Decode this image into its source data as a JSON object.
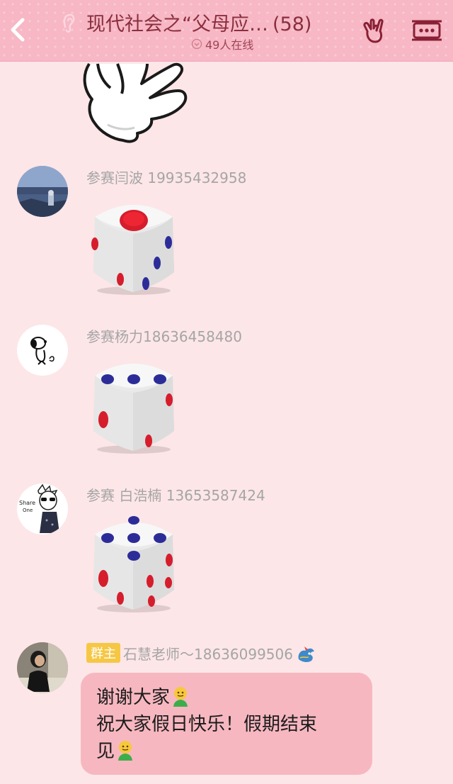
{
  "header": {
    "title": "现代社会之“父母应…",
    "member_count": "(58)",
    "online_status": "49人在线"
  },
  "messages": [
    {
      "sender": "参赛闫波 19935432958",
      "content_type": "dice",
      "dice_value": 1
    },
    {
      "sender": "参赛杨力18636458480",
      "content_type": "dice",
      "dice_value": 3
    },
    {
      "sender": "参赛 白浩楠 13653587424",
      "content_type": "dice",
      "dice_value": 5
    },
    {
      "badge": "群主",
      "sender": "石慧老师～18636099506",
      "content_type": "text",
      "lines": [
        "谢谢大家",
        "祝大家假日快乐！假期结束",
        "见"
      ]
    }
  ],
  "avatar_4_overlay_text": {
    "line1": "Share",
    "line2": "One"
  }
}
